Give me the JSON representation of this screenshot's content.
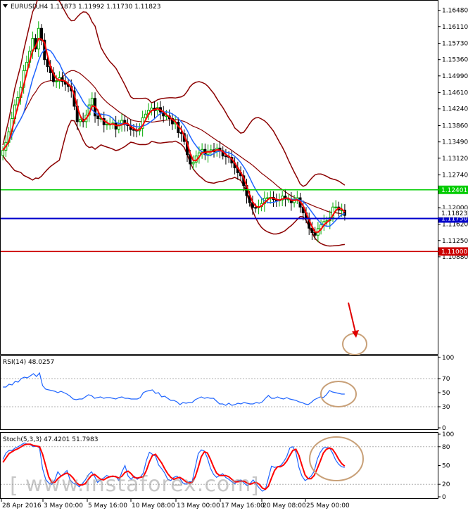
{
  "chart_data": {
    "type": "candlestick",
    "symbol_header": "EURUSD,H4  1.11873 1.11992 1.11730 1.11823",
    "price_axis": {
      "range": [
        1.0872,
        1.1665
      ],
      "ticks": [
        "1.16480",
        "1.16110",
        "1.15730",
        "1.15360",
        "1.14990",
        "1.14610",
        "1.14240",
        "1.13860",
        "1.13490",
        "1.13120",
        "1.12740",
        "1.12000",
        "1.11620",
        "1.11250",
        "1.10880"
      ]
    },
    "levels": [
      {
        "name": "resistance",
        "value": 1.12401,
        "label": "1.12401",
        "color": "#00cc00"
      },
      {
        "name": "pivot",
        "value": 1.1175,
        "label": "1.11750",
        "color": "#0000cc"
      },
      {
        "name": "support",
        "value": 1.11,
        "label": "1.11000",
        "color": "#cc0000"
      }
    ],
    "current_price": {
      "value": 1.11823,
      "label": "1.11823"
    },
    "time_axis": [
      "28 Apr 2016",
      "3 May 00:00",
      "5 May 16:00",
      "10 May 08:00",
      "13 May 00:00",
      "17 May 16:00",
      "20 May 08:00",
      "25 May 00:00"
    ],
    "close": [
      1.133,
      1.1348,
      1.1372,
      1.1402,
      1.1433,
      1.145,
      1.1473,
      1.1511,
      1.153,
      1.1555,
      1.1584,
      1.156,
      1.1607,
      1.158,
      1.1536,
      1.152,
      1.1506,
      1.1486,
      1.1487,
      1.1495,
      1.1486,
      1.148,
      1.1475,
      1.1465,
      1.143,
      1.1395,
      1.14,
      1.1395,
      1.141,
      1.1433,
      1.1448,
      1.1408,
      1.1402,
      1.1402,
      1.1388,
      1.1389,
      1.1389,
      1.1392,
      1.1378,
      1.1388,
      1.1398,
      1.1388,
      1.1386,
      1.1377,
      1.1376,
      1.1374,
      1.138,
      1.1404,
      1.1412,
      1.1421,
      1.1426,
      1.142,
      1.1427,
      1.1417,
      1.1408,
      1.1408,
      1.1402,
      1.139,
      1.1394,
      1.137,
      1.1368,
      1.135,
      1.132,
      1.1299,
      1.1303,
      1.1317,
      1.1324,
      1.1332,
      1.132,
      1.1328,
      1.1331,
      1.1327,
      1.1335,
      1.1329,
      1.1317,
      1.1316,
      1.1314,
      1.1301,
      1.129,
      1.1279,
      1.1272,
      1.125,
      1.1227,
      1.1211,
      1.12,
      1.1199,
      1.1202,
      1.1209,
      1.1221,
      1.1222,
      1.1223,
      1.1218,
      1.1215,
      1.1217,
      1.1226,
      1.1219,
      1.1219,
      1.1211,
      1.1219,
      1.1222,
      1.1201,
      1.1188,
      1.1174,
      1.1153,
      1.1143,
      1.1137,
      1.1152,
      1.1161,
      1.1168,
      1.117,
      1.1177,
      1.1201,
      1.1201,
      1.1194,
      1.1194,
      1.1182
    ],
    "rsi": {
      "title": "RSI(14) 48.0257",
      "range": [
        0,
        100
      ],
      "ticks": [
        "100",
        "70",
        "50",
        "30",
        "0"
      ],
      "values": [
        58,
        58,
        62,
        61,
        66,
        65,
        70,
        72,
        71,
        74,
        77,
        73,
        78,
        60,
        55,
        54,
        53,
        52,
        50,
        52,
        50,
        48,
        45,
        41,
        40,
        41,
        41,
        44,
        47,
        46,
        42,
        43,
        44,
        42,
        43,
        43,
        42,
        41,
        43,
        44,
        42,
        42,
        41,
        41,
        41,
        43,
        50,
        52,
        53,
        54,
        49,
        50,
        44,
        45,
        42,
        39,
        39,
        37,
        33,
        36,
        35,
        36,
        36,
        40,
        42,
        44,
        42,
        43,
        42,
        42,
        38,
        34,
        34,
        32,
        35,
        32,
        33,
        35,
        34,
        36,
        35,
        34,
        34,
        36,
        35,
        37,
        42,
        46,
        42,
        42,
        44,
        42,
        41,
        43,
        41,
        40,
        39,
        37,
        36,
        34,
        33,
        36,
        40,
        42,
        44,
        43,
        47,
        53,
        51,
        50,
        49,
        48,
        48
      ]
    },
    "stoch": {
      "title": "Stoch(5,3,3) 47.4201 51.7983",
      "range": [
        0,
        100
      ],
      "ticks": [
        "100",
        "80",
        "50",
        "20",
        "0"
      ],
      "k": [
        60,
        70,
        74,
        74,
        78,
        80,
        83,
        86,
        84,
        83,
        80,
        81,
        78,
        45,
        28,
        22,
        20,
        27,
        40,
        33,
        37,
        42,
        27,
        22,
        20,
        16,
        21,
        27,
        35,
        40,
        33,
        23,
        27,
        30,
        34,
        32,
        32,
        33,
        26,
        40,
        50,
        33,
        28,
        33,
        28,
        31,
        38,
        58,
        71,
        68,
        65,
        51,
        45,
        38,
        28,
        26,
        31,
        33,
        29,
        22,
        20,
        24,
        24,
        47,
        69,
        75,
        73,
        62,
        46,
        36,
        31,
        34,
        37,
        31,
        28,
        24,
        21,
        26,
        27,
        22,
        18,
        21,
        27,
        20,
        14,
        9,
        12,
        30,
        49,
        47,
        48,
        50,
        56,
        64,
        78,
        80,
        71,
        47,
        33,
        26,
        29,
        33,
        41,
        60,
        71,
        78,
        79,
        78,
        70,
        59,
        52,
        48,
        47
      ],
      "d": [
        55,
        62,
        69,
        72,
        75,
        77,
        80,
        83,
        84,
        84,
        82,
        81,
        80,
        68,
        50,
        32,
        23,
        23,
        29,
        33,
        36,
        38,
        35,
        30,
        23,
        19,
        19,
        21,
        28,
        34,
        36,
        32,
        28,
        27,
        30,
        32,
        33,
        32,
        30,
        33,
        39,
        41,
        37,
        31,
        30,
        31,
        32,
        42,
        56,
        66,
        68,
        61,
        54,
        45,
        37,
        31,
        28,
        30,
        31,
        28,
        24,
        22,
        23,
        32,
        47,
        64,
        72,
        70,
        60,
        48,
        38,
        34,
        34,
        34,
        32,
        28,
        24,
        24,
        25,
        25,
        22,
        20,
        22,
        23,
        20,
        14,
        12,
        17,
        30,
        42,
        48,
        48,
        51,
        57,
        66,
        74,
        76,
        66,
        50,
        35,
        29,
        29,
        34,
        45,
        57,
        70,
        76,
        78,
        76,
        69,
        60,
        53,
        49
      ]
    }
  },
  "watermark": "www.instaforex.com",
  "colors": {
    "bull_candle": "#00aa00",
    "bear_candle": "#000000",
    "ma_fast": "#ff0000",
    "ma_slow": "#1e64ff",
    "bollinger": "#8b0000",
    "rsi_line": "#1e64ff",
    "annotation": "#c8a078"
  }
}
